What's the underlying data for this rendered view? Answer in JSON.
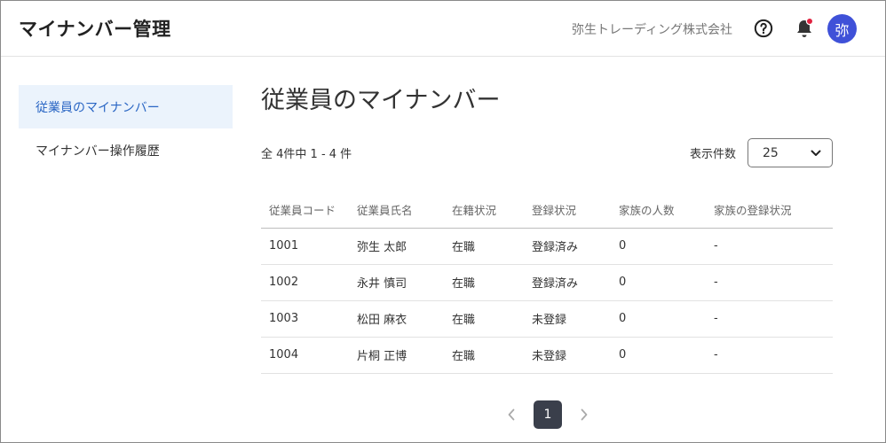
{
  "header": {
    "app_title": "マイナンバー管理",
    "company_name": "弥生トレーディング株式会社",
    "avatar_initial": "弥",
    "notification_dot_color": "#e0223f"
  },
  "sidebar": {
    "items": [
      {
        "label": "従業員のマイナンバー",
        "active": true
      },
      {
        "label": "マイナンバー操作履歴",
        "active": false
      }
    ]
  },
  "main": {
    "title": "従業員のマイナンバー",
    "count_text": "全 4件中 1 - 4 件",
    "per_page_label": "表示件数",
    "per_page_value": "25",
    "table": {
      "headers": [
        "従業員コード",
        "従業員氏名",
        "在籍状況",
        "登録状況",
        "家族の人数",
        "家族の登録状況"
      ],
      "rows": [
        [
          "1001",
          "弥生 太郎",
          "在職",
          "登録済み",
          "0",
          "-"
        ],
        [
          "1002",
          "永井 慎司",
          "在職",
          "登録済み",
          "0",
          "-"
        ],
        [
          "1003",
          "松田 麻衣",
          "在職",
          "未登録",
          "0",
          "-"
        ],
        [
          "1004",
          "片桐 正博",
          "在職",
          "未登録",
          "0",
          "-"
        ]
      ]
    },
    "pagination": {
      "current_page": "1",
      "prev_icon": "chevron-left-icon",
      "next_icon": "chevron-right-icon"
    }
  }
}
